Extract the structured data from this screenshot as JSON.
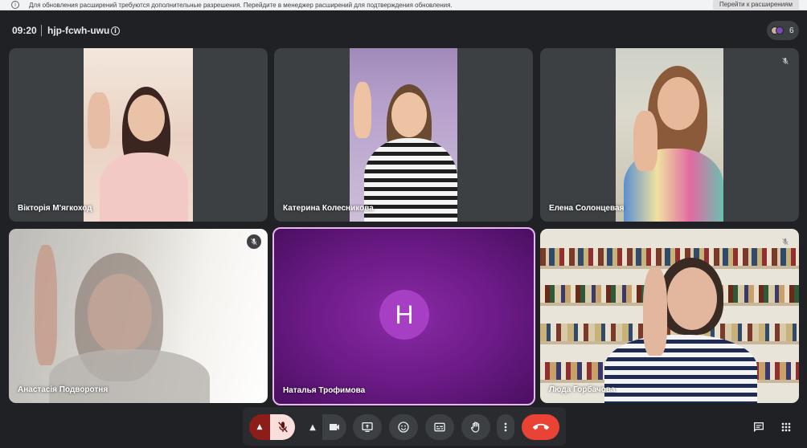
{
  "banner": {
    "message": "Для обновления расширений требуются дополнительные разрешения. Перейдите в менеджер расширений для подтверждения обновления.",
    "button_label": "Перейти к расширениям"
  },
  "header": {
    "time": "09:20",
    "meeting_code": "hjp-fcwh-uwu",
    "participant_count": "6"
  },
  "participants": [
    {
      "name": "Вікторія М'ягкоход",
      "muted": false
    },
    {
      "name": "Катерина Колесникова",
      "muted": false
    },
    {
      "name": "Елена Солонцевая",
      "muted": true
    },
    {
      "name": "Анастасія Подворотня",
      "muted": true
    },
    {
      "name": "Наталья Трофимова",
      "muted": false,
      "avatar_letter": "H",
      "camera_off": true,
      "speaking_highlight": true
    },
    {
      "name": "Люда Горбачова",
      "muted": true
    }
  ],
  "toolbar": {
    "mic_state": "muted",
    "buttons": [
      "mic",
      "camera",
      "present",
      "emoji",
      "captions",
      "raise-hand",
      "more",
      "leave-call"
    ]
  },
  "colors": {
    "background": "#202124",
    "tile": "#3c4043",
    "avatar_bg": "#a63fc4",
    "end_call": "#ea4335",
    "mic_muted_bg": "#f9dedc",
    "highlight_border": "#e8b6f0"
  }
}
